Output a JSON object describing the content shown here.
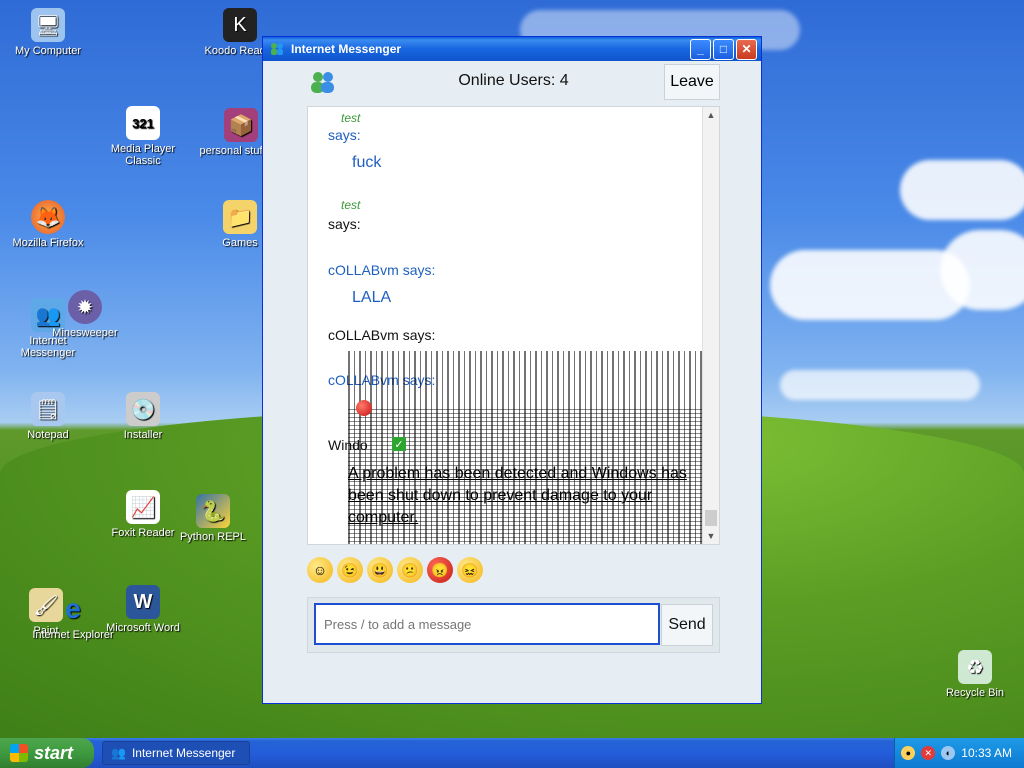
{
  "desktop": {
    "icons": [
      {
        "label": "My Computer"
      },
      {
        "label": "Koodo Reader"
      },
      {
        "label": "Media Player Classic"
      },
      {
        "label": "personal stuff.zip"
      },
      {
        "label": "Mozilla Firefox"
      },
      {
        "label": "Games"
      },
      {
        "label": "Internet Messenger"
      },
      {
        "label": "Minesweeper"
      },
      {
        "label": "Notepad"
      },
      {
        "label": "Installer"
      },
      {
        "label": "Foxit Reader"
      },
      {
        "label": "Python REPL"
      },
      {
        "label": "Paint"
      },
      {
        "label": "Internet Explorer"
      },
      {
        "label": "Microsoft Word"
      },
      {
        "label": "Recycle Bin"
      }
    ]
  },
  "window": {
    "title": "Internet Messenger",
    "minimize_label": "_",
    "maximize_label": "□",
    "close_label": "✕"
  },
  "header": {
    "online_users": "Online Users: 4",
    "leave_label": "Leave"
  },
  "chat": {
    "messages": [
      {
        "name": "test",
        "says": "says:",
        "body": "fuck"
      },
      {
        "name": "test",
        "says": "says:",
        "body": ""
      },
      {
        "says": "cOLLABvm says:",
        "body": "LALA"
      },
      {
        "says": "cOLLABvm says:",
        "body": ""
      },
      {
        "says": "cOLLABvm says:",
        "body": ""
      }
    ],
    "glitch_prefix": "Windo",
    "glitch_text": "A problem has been detected and Windows has been shut down to prevent damage to your computer."
  },
  "emojis": [
    "☺",
    "😉",
    "😃",
    "😕",
    "😠",
    "😖"
  ],
  "input": {
    "placeholder": "Press / to add a message",
    "send_label": "Send"
  },
  "taskbar": {
    "start_label": "start",
    "task_label": "Internet Messenger",
    "clock": "10:33 AM"
  }
}
